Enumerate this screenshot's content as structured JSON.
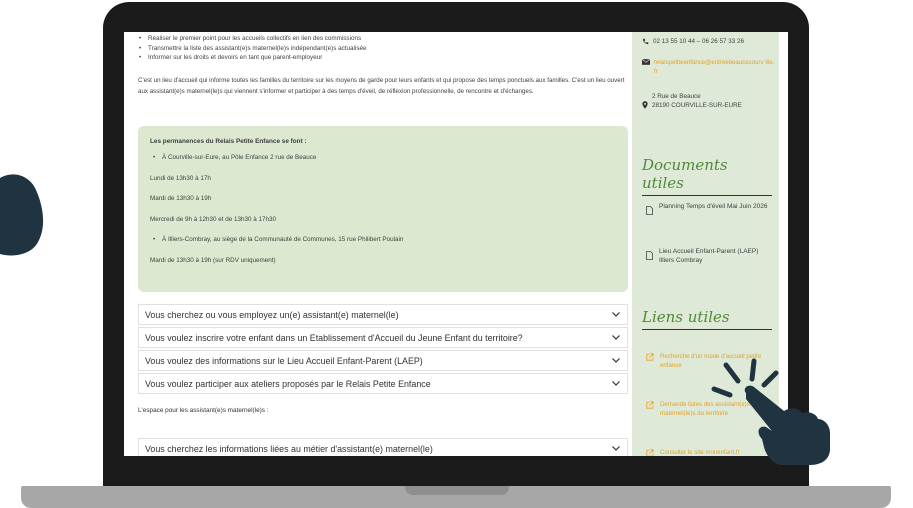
{
  "page": {
    "bullets": [
      "Réaliser le premier point pour les accueils collectifs en lien des commissions",
      "Transmettre la liste des assistant(e)s maternel(le)s indépendant(e)s actualisée",
      "Informer sur les droits et devoirs en tant que parent-employeur"
    ],
    "intro": "C'est un lieu d'accueil qui informe toutes les familles du territoire sur les moyens de garde pour leurs enfants et qui propose des temps ponctuels aux familles. C'est un lieu ouvert aux assistant(e)s maternel(le)s qui viennent s'informer et participer à des temps d'éveil, de réflexion professionnelle, de rencontre et d'échanges.",
    "permanences": {
      "title": "Les permanences du Relais Petite Enfance se font :",
      "lines": [
        "À Courville-sur-Eure, au Pôle Enfance 2 rue de Beauce",
        "Lundi de 13h30 à 17h",
        "Mardi de 13h30 à 19h",
        "Mercredi de 9h à 12h30 et de 13h30 à 17h30",
        "À Illiers-Combray, au siège de la Communauté de Communes, 15 rue Philibert Poulain",
        "Mardi de 13h30 à 19h (sur RDV uniquement)"
      ]
    },
    "accordions": [
      "Vous cherchez ou vous employez un(e) assistant(e) maternel(le)",
      "Vous voulez inscrire votre enfant dans un Etablissement d'Accueil du Jeune Enfant du territoire?",
      "Vous voulez des informations sur le Lieu Accueil Enfant-Parent (LAEP)",
      "Vous voulez participer aux ateliers proposés par le Relais Petite Enfance"
    ],
    "space_label": "L'espace pour les assistant(e)s maternel(le)s :",
    "accordion_last": "Vous cherchez les informations liées au métier d'assistant(e) maternel(le)"
  },
  "sidebar": {
    "phone": "02 13 55 10 44 – 06 26 57 33 26",
    "email": "relaispetiteenfance@entreebeaucecourv ille.fr",
    "address_line1": "2 Rue de Beauce",
    "address_line2": "28190 COURVILLE-SUR-EURE",
    "documents_heading": "Documents utiles",
    "documents": [
      "Planning Temps d'éveil Mai Juin 2026",
      "Lieu Accueil Enfant-Parent (LAEP) Illiers Combray"
    ],
    "links_heading": "Liens utiles",
    "links": [
      "Recherche d'un mode d'accueil petite enfance",
      "Demande listes des assistant(e)s maternel(le)s du territoire",
      "Consulter le site monenfant.fr"
    ]
  },
  "colors": {
    "accent_green": "#4f8a3a",
    "sidebar_bg": "#dfe9d8",
    "box_bg": "#dde8d1",
    "link_orange": "#e1a32b",
    "hand_color": "#1f3340"
  },
  "icons": [
    "phone-icon",
    "mail-icon",
    "location-pin-icon",
    "document-icon",
    "external-link-icon",
    "chevron-down-icon",
    "pointing-hand-icon"
  ]
}
